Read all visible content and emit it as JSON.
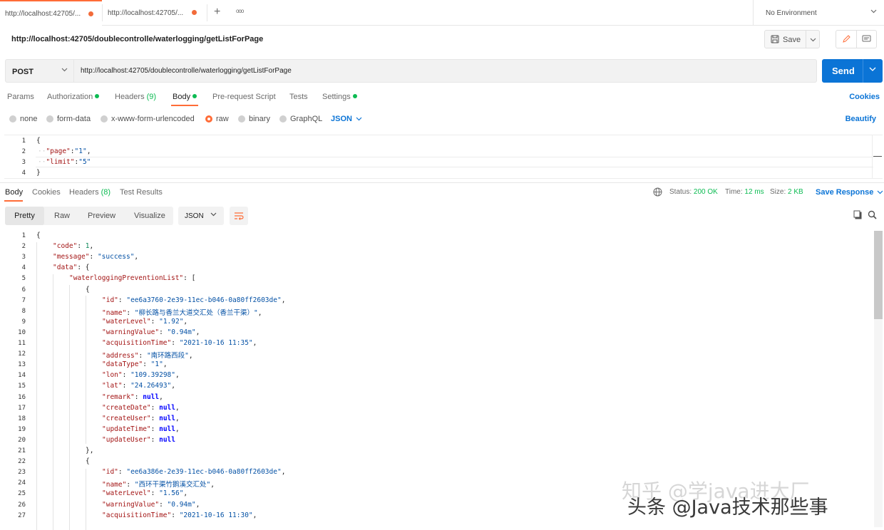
{
  "tabs": [
    {
      "label": "http://localhost:42705/...",
      "unsaved": true
    },
    {
      "label": "http://localhost:42705/...",
      "unsaved": true
    }
  ],
  "tab_actions": {
    "add": "+",
    "more": "ooo"
  },
  "environment": "No Environment",
  "request": {
    "title": "http://localhost:42705/doublecontrolle/waterlogging/getListForPage",
    "save_label": "Save",
    "method": "POST",
    "url": "http://localhost:42705/doublecontrolle/waterlogging/getListForPage",
    "send_label": "Send"
  },
  "request_tabs": {
    "params": "Params",
    "authorization": "Authorization",
    "headers": "Headers",
    "headers_count": "(9)",
    "body": "Body",
    "prerequest": "Pre-request Script",
    "tests": "Tests",
    "settings": "Settings",
    "cookies": "Cookies"
  },
  "body_types": {
    "none": "none",
    "form_data": "form-data",
    "urlencoded": "x-www-form-urlencoded",
    "raw": "raw",
    "binary": "binary",
    "graphql": "GraphQL",
    "format": "JSON",
    "beautify": "Beautify"
  },
  "request_body_lines": [
    "1",
    "2",
    "3",
    "4"
  ],
  "request_body": {
    "open": "{",
    "l2_key": "\"page\"",
    "l2_val": "\"1\"",
    "l3_key": "\"limit\"",
    "l3_val": "\"5\"",
    "close": "}"
  },
  "response_tabs": {
    "body": "Body",
    "cookies": "Cookies",
    "headers": "Headers",
    "headers_count": "(8)",
    "test_results": "Test Results"
  },
  "response_status": {
    "status_label": "Status:",
    "status_value": "200 OK",
    "time_label": "Time:",
    "time_value": "12 ms",
    "size_label": "Size:",
    "size_value": "2 KB",
    "save_response": "Save Response"
  },
  "response_view": {
    "pretty": "Pretty",
    "raw": "Raw",
    "preview": "Preview",
    "visualize": "Visualize",
    "format": "JSON"
  },
  "response_lines": [
    "1",
    "2",
    "3",
    "4",
    "5",
    "6",
    "7",
    "8",
    "9",
    "10",
    "11",
    "12",
    "13",
    "14",
    "15",
    "16",
    "17",
    "18",
    "19",
    "20",
    "21",
    "22",
    "23",
    "24",
    "25",
    "26",
    "27"
  ],
  "response": {
    "l1": "{",
    "code_key": "\"code\"",
    "code_val": "1",
    "message_key": "\"message\"",
    "message_val": "\"success\"",
    "data_key": "\"data\"",
    "data_open": "{",
    "list_key": "\"waterloggingPreventionList\"",
    "list_open": "[",
    "item1": {
      "open": "{",
      "id_key": "\"id\"",
      "id_val": "\"ee6a3760-2e39-11ec-b046-0a80ff2603de\"",
      "name_key": "\"name\"",
      "name_val": "\"柳长路与香兰大道交汇处（香兰干渠）\"",
      "waterLevel_key": "\"waterLevel\"",
      "waterLevel_val": "\"1.92\"",
      "warningValue_key": "\"warningValue\"",
      "warningValue_val": "\"0.94m\"",
      "acquisitionTime_key": "\"acquisitionTime\"",
      "acquisitionTime_val": "\"2021-10-16 11:35\"",
      "address_key": "\"address\"",
      "address_val": "\"南环路西段\"",
      "dataType_key": "\"dataType\"",
      "dataType_val": "\"1\"",
      "lon_key": "\"lon\"",
      "lon_val": "\"109.39298\"",
      "lat_key": "\"lat\"",
      "lat_val": "\"24.26493\"",
      "remark_key": "\"remark\"",
      "remark_val": "null",
      "createDate_key": "\"createDate\"",
      "createDate_val": "null",
      "createUser_key": "\"createUser\"",
      "createUser_val": "null",
      "updateTime_key": "\"updateTime\"",
      "updateTime_val": "null",
      "updateUser_key": "\"updateUser\"",
      "updateUser_val": "null",
      "close": "},"
    },
    "item2": {
      "open": "{",
      "id_key": "\"id\"",
      "id_val": "\"ee6a386e-2e39-11ec-b046-0a80ff2603de\"",
      "name_key": "\"name\"",
      "name_val": "\"西环干渠竹鹅溪交汇处\"",
      "waterLevel_key": "\"waterLevel\"",
      "waterLevel_val": "\"1.56\"",
      "warningValue_key": "\"warningValue\"",
      "warningValue_val": "\"0.94m\"",
      "acquisitionTime_key": "\"acquisitionTime\"",
      "acquisitionTime_val": "\"2021-10-16 11:30\""
    }
  },
  "watermark": {
    "line1": "知乎 @学java进大厂",
    "line2": "头条 @Java技术那些事"
  },
  "colors": {
    "accent": "#ff6c37",
    "primary": "#0b74d6",
    "success": "#0cbb52"
  }
}
